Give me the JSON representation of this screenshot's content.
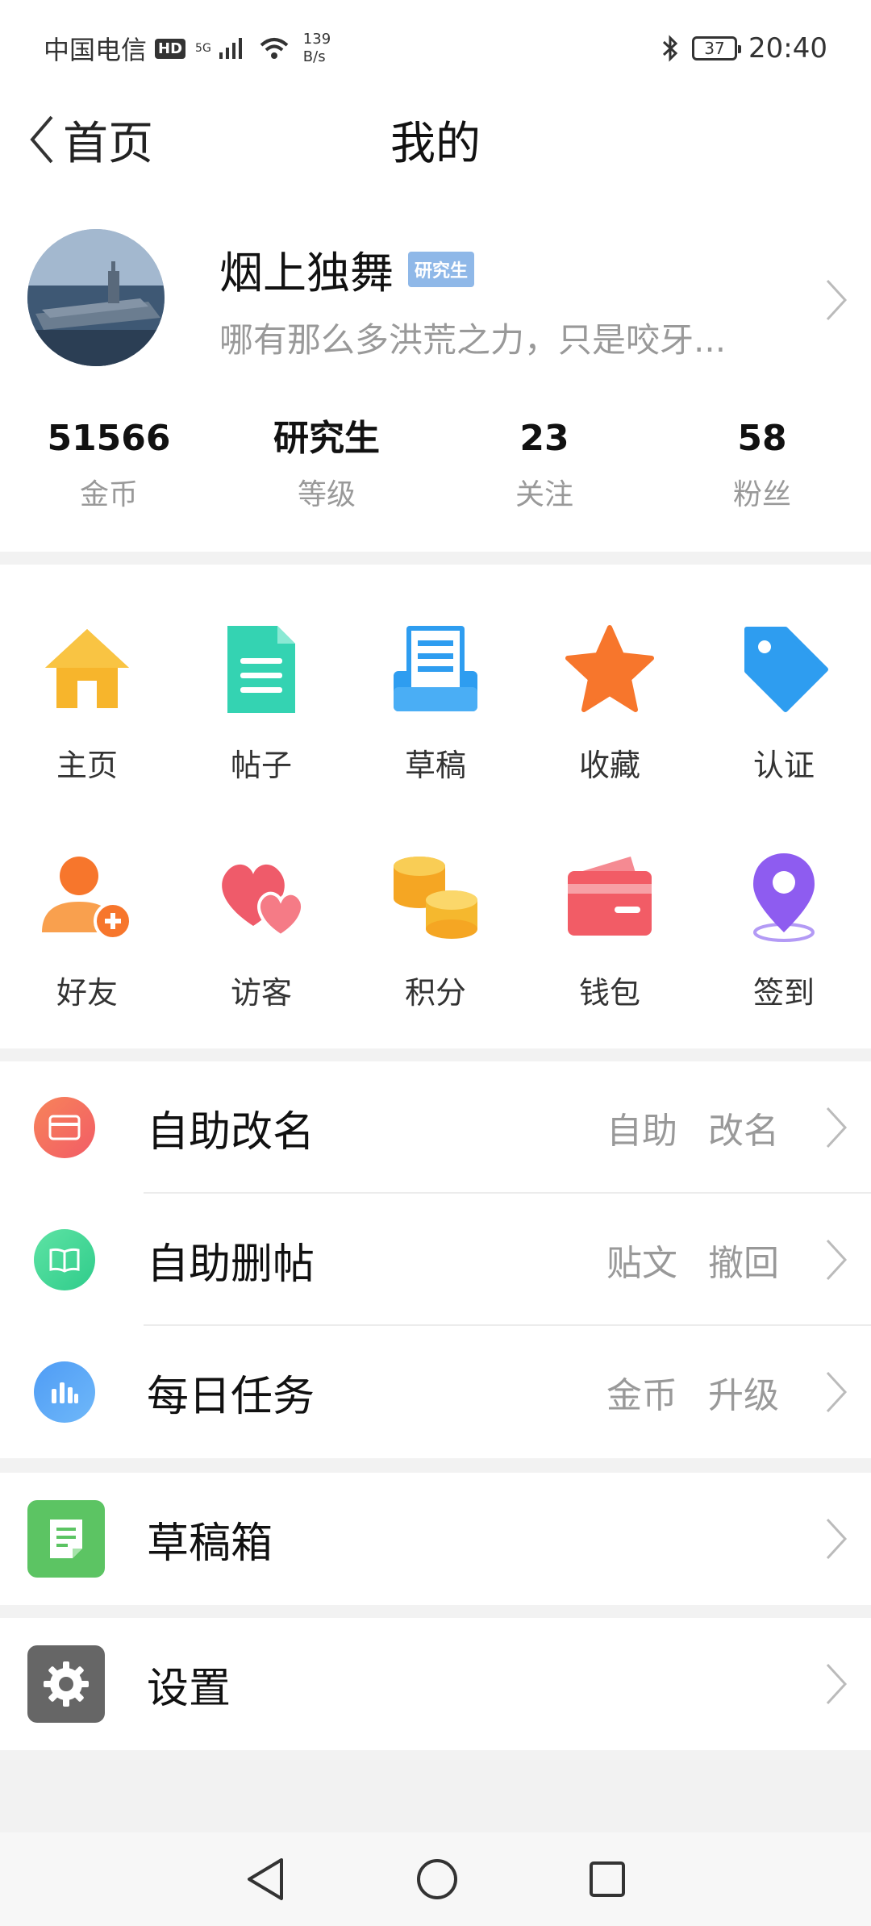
{
  "status_bar": {
    "carrier": "中国电信",
    "hd": "HD",
    "network": "5G",
    "speed_value": "139",
    "speed_unit": "B/s",
    "battery": "37",
    "time": "20:40"
  },
  "nav": {
    "back_label": "首页",
    "title": "我的"
  },
  "profile": {
    "name": "烟上独舞",
    "level_badge": "研究生",
    "signature": "哪有那么多洪荒之力，只是咬牙..."
  },
  "stats": [
    {
      "value": "51566",
      "label": "金币"
    },
    {
      "value": "研究生",
      "label": "等级"
    },
    {
      "value": "23",
      "label": "关注"
    },
    {
      "value": "58",
      "label": "粉丝"
    }
  ],
  "grid": [
    {
      "label": "主页",
      "icon": "home-icon",
      "color": "#f7b52c"
    },
    {
      "label": "帖子",
      "icon": "document-icon",
      "color": "#34d3b2"
    },
    {
      "label": "草稿",
      "icon": "draft-tray-icon",
      "color": "#2e9df0"
    },
    {
      "label": "收藏",
      "icon": "star-icon",
      "color": "#f7762c"
    },
    {
      "label": "认证",
      "icon": "tag-icon",
      "color": "#2e9df0"
    },
    {
      "label": "好友",
      "icon": "add-friend-icon",
      "color": "#f7762c"
    },
    {
      "label": "访客",
      "icon": "hearts-icon",
      "color": "#ef5b6a"
    },
    {
      "label": "积分",
      "icon": "coins-icon",
      "color": "#f5b82e"
    },
    {
      "label": "钱包",
      "icon": "wallet-icon",
      "color": "#f25c66"
    },
    {
      "label": "签到",
      "icon": "location-pin-icon",
      "color": "#8e5cf0"
    }
  ],
  "list_section_1": [
    {
      "label": "自助改名",
      "tags": [
        "自助",
        "改名"
      ],
      "icon": "card-icon",
      "color": "#f56b5f"
    },
    {
      "label": "自助删帖",
      "tags": [
        "贴文",
        "撤回"
      ],
      "icon": "book-icon",
      "color": "#3fd68e"
    },
    {
      "label": "每日任务",
      "tags": [
        "金币",
        "升级"
      ],
      "icon": "bar-chart-icon",
      "color": "#4f9cf5"
    }
  ],
  "list_section_2": {
    "label": "草稿箱",
    "icon": "note-icon",
    "color": "#5cc463"
  },
  "list_section_3": {
    "label": "设置",
    "icon": "gear-icon",
    "color": "#666666"
  }
}
